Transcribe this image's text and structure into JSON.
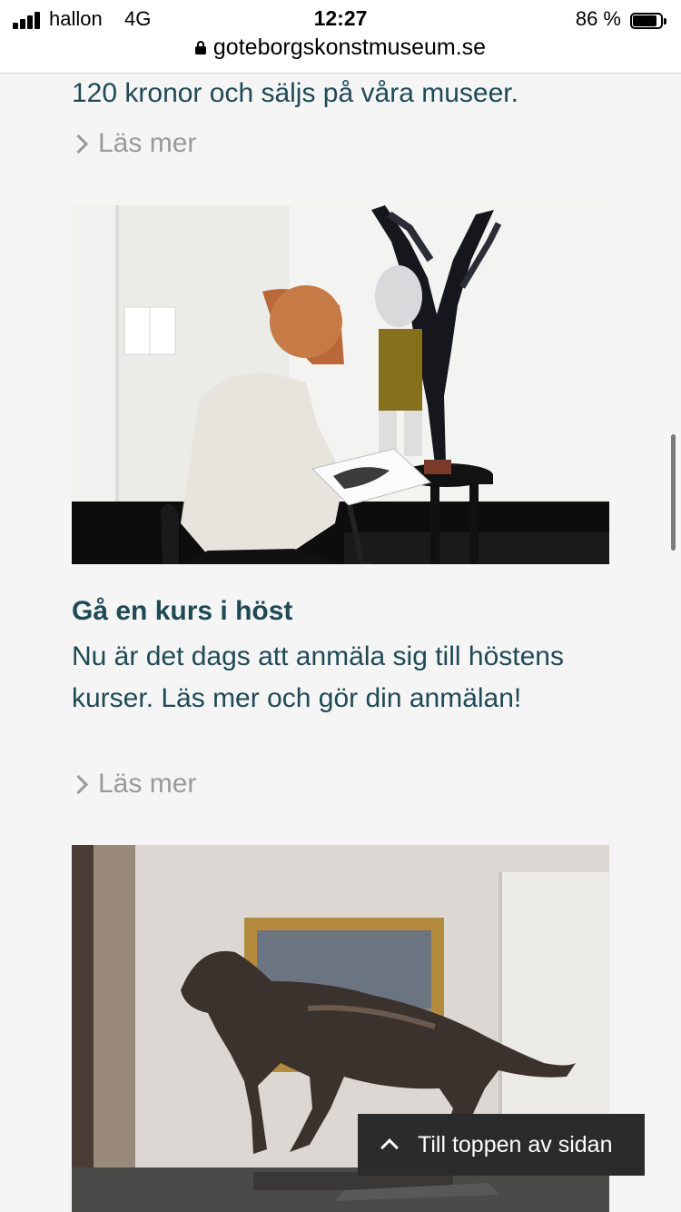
{
  "status": {
    "carrier": "hallon",
    "network": "4G",
    "time": "12:27",
    "battery": "86 %",
    "battery_level": 0.86
  },
  "browser": {
    "url": "goteborgskonstmuseum.se"
  },
  "articles": [
    {
      "text": "120 kronor och säljs på våra museer.",
      "read_more": "Läs mer"
    },
    {
      "title": "Gå en kurs i höst",
      "text": "Nu är det dags att anmäla sig till höstens kurser. Läs mer och gör din anmälan!",
      "read_more": "Läs mer"
    }
  ],
  "back_to_top": {
    "label": "Till toppen av sidan"
  },
  "icons": {
    "lock": "lock-icon",
    "chevron_right": "chevron-right-icon",
    "chevron_up": "chevron-up-icon"
  }
}
